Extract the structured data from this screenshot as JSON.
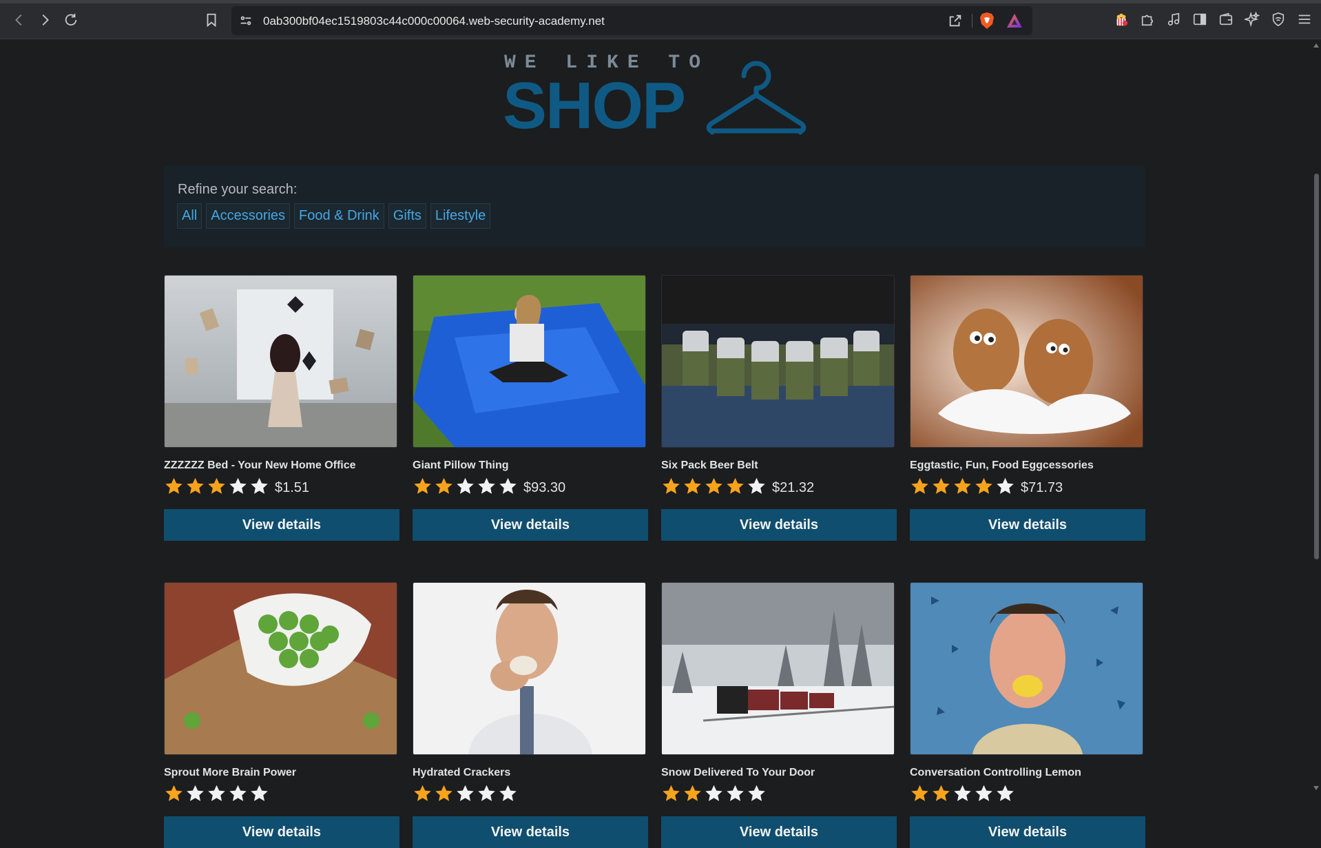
{
  "browser": {
    "url": "0ab300bf04ec1519803c44c000c00064.web-security-academy.net"
  },
  "logo": {
    "tagline": "WE LIKE TO",
    "word": "SHOP"
  },
  "filter": {
    "label": "Refine your search:",
    "categories": [
      "All",
      "Accessories",
      "Food & Drink",
      "Gifts",
      "Lifestyle"
    ]
  },
  "products": [
    {
      "name": "ZZZZZZ Bed - Your New Home Office",
      "rating": 3,
      "price": "$1.51",
      "button": "View details",
      "image": "woman-flying-books"
    },
    {
      "name": "Giant Pillow Thing",
      "rating": 2,
      "price": "$93.30",
      "button": "View details",
      "image": "girl-on-blue-bean-bag"
    },
    {
      "name": "Six Pack Beer Belt",
      "rating": 4,
      "price": "$21.32",
      "button": "View details",
      "image": "camo-beer-belt"
    },
    {
      "name": "Eggtastic, Fun, Food Eggcessories",
      "rating": 4,
      "price": "$71.73",
      "button": "View details",
      "image": "eggs-with-eyes"
    },
    {
      "name": "Sprout More Brain Power",
      "rating": 1,
      "price": "",
      "button": "View details",
      "image": "brussels-sprouts-bowl"
    },
    {
      "name": "Hydrated Crackers",
      "rating": 2,
      "price": "",
      "button": "View details",
      "image": "man-eating-cracker"
    },
    {
      "name": "Snow Delivered To Your Door",
      "rating": 2,
      "price": "",
      "button": "View details",
      "image": "steam-train-in-snow"
    },
    {
      "name": "Conversation Controlling Lemon",
      "rating": 2,
      "price": "",
      "button": "View details",
      "image": "man-biting-lemon"
    }
  ],
  "colors": {
    "page_bg": "#1b1d1f",
    "accent": "#0f5a84",
    "button_bg": "#0f4e6f",
    "link": "#47a6e4",
    "star": "#f7a31b"
  }
}
